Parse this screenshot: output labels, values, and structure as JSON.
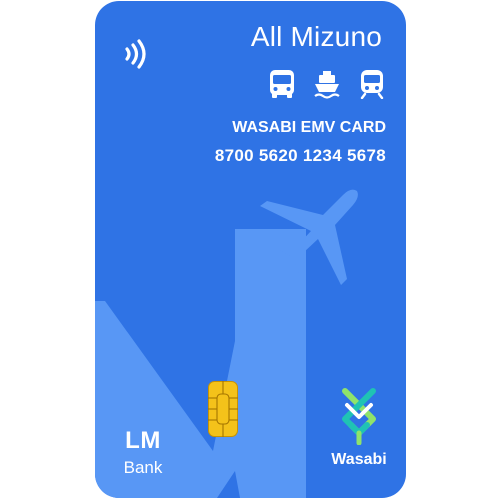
{
  "card": {
    "holder_name": "All Mizuno",
    "card_type": "WASABI EMV CARD",
    "card_number": "8700 5620 1234 5678",
    "background_color": "#2f73e5",
    "art_color": "#5897f5",
    "transit_icons": [
      "bus-icon",
      "ferry-icon",
      "train-icon"
    ],
    "contactless_icon": "contactless-icon",
    "chip_icon": "emv-chip-icon",
    "bank_logo": {
      "mark": "LM",
      "name": "Bank"
    },
    "network_logo": {
      "name": "Wasabi",
      "colors": [
        "#8fe36b",
        "#1fc3b4",
        "#ffffff"
      ]
    }
  }
}
